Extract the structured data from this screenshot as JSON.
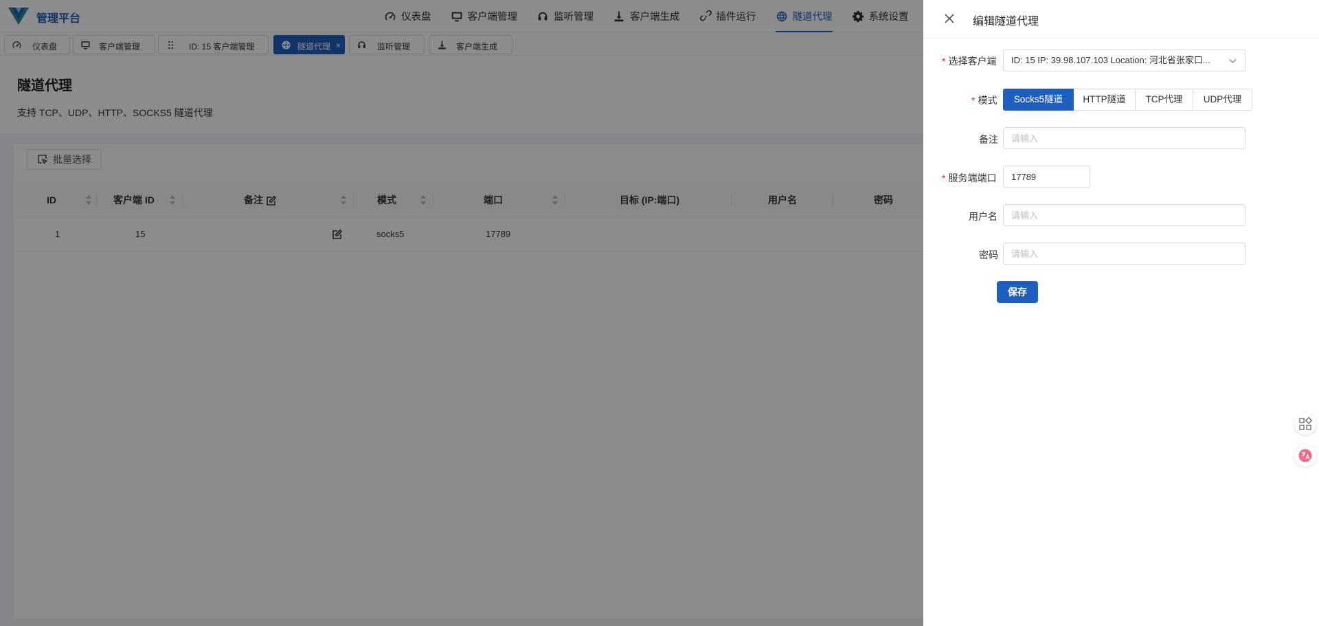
{
  "app": {
    "brand": "管理平台",
    "nav": [
      {
        "label": "仪表盘",
        "icon": "dashboard-icon"
      },
      {
        "label": "客户端管理",
        "icon": "monitor-icon"
      },
      {
        "label": "监听管理",
        "icon": "headphones-icon"
      },
      {
        "label": "客户端生成",
        "icon": "download-icon"
      },
      {
        "label": "插件运行",
        "icon": "link-icon"
      },
      {
        "label": "隧道代理",
        "icon": "globe-icon",
        "active": true
      },
      {
        "label": "系统设置",
        "icon": "gear-icon"
      }
    ],
    "tabs": [
      {
        "label": "仪表盘",
        "icon": "dashboard-icon"
      },
      {
        "label": "客户端管理",
        "icon": "monitor-icon"
      },
      {
        "label": "ID: 15 客户端管理",
        "icon": "drag-icon"
      },
      {
        "label": "隧道代理",
        "icon": "globe-icon",
        "active": true,
        "close": "×"
      },
      {
        "label": "监听管理",
        "icon": "headphones-icon"
      },
      {
        "label": "客户端生成",
        "icon": "download-icon"
      }
    ],
    "accent_color": "#1f5fbf"
  },
  "page": {
    "title": "隧道代理",
    "description": "支持 TCP、UDP、HTTP、SOCKS5 隧道代理",
    "batch_select_label": "批量选择"
  },
  "table": {
    "columns": [
      "ID",
      "客户端 ID",
      "备注",
      "模式",
      "端口",
      "目标 (IP:端口)",
      "用户名",
      "密码"
    ],
    "rows": [
      {
        "id": "1",
        "client_id": "15",
        "remark": "",
        "mode": "socks5",
        "port": "17789",
        "target": "",
        "username": "",
        "password": ""
      }
    ]
  },
  "drawer": {
    "title": "编辑隧道代理",
    "fields": {
      "client": {
        "label": "选择客户端",
        "required": true,
        "value": "ID: 15 IP: 39.98.107.103 Location: 河北省张家口..."
      },
      "mode": {
        "label": "模式",
        "required": true,
        "options": [
          "Socks5隧道",
          "HTTP隧道",
          "TCP代理",
          "UDP代理"
        ],
        "selected": "Socks5隧道"
      },
      "remark": {
        "label": "备注",
        "placeholder": "请输入",
        "value": ""
      },
      "server_port": {
        "label": "服务端端口",
        "required": true,
        "value": "17789"
      },
      "username": {
        "label": "用户名",
        "placeholder": "请输入",
        "value": ""
      },
      "password": {
        "label": "密码",
        "placeholder": "请输入",
        "value": ""
      }
    },
    "save_label": "保存"
  },
  "required_mark": "*"
}
